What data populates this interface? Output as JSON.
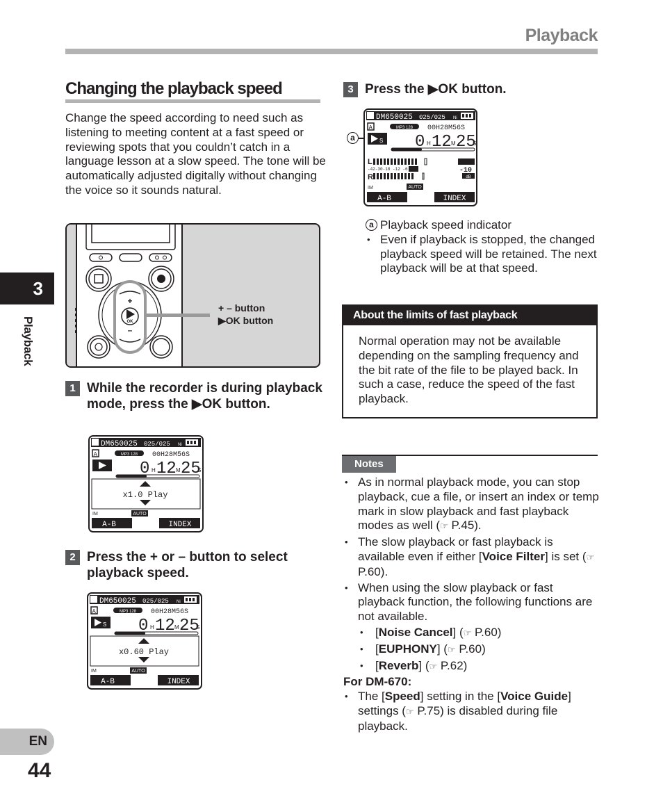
{
  "header": {
    "title": "Playback"
  },
  "side_tab": {
    "chapter_number": "3",
    "chapter_label": "Playback",
    "language": "EN",
    "page_number": "44"
  },
  "section": {
    "title": "Changing the playback speed",
    "intro": "Change the speed according to need such as listening to meeting content at a fast speed or reviewing spots that you couldn’t catch in a language lesson at a slow speed. The tone will be automatically adjusted digitally without changing the voice so it sounds natural."
  },
  "device_figure": {
    "label_plus_minus": "+ – button",
    "label_ok": "▶OK button",
    "plus_glyph": "+",
    "minus_glyph": "–",
    "ok_glyph": "OK"
  },
  "steps": [
    {
      "number": "1",
      "text": "While the recorder is during playback mode, press the ▶OK button."
    },
    {
      "number": "2",
      "text": "Press the + or – button to select playback speed."
    },
    {
      "number": "3",
      "text": "Press the ▶OK button."
    }
  ],
  "lcd_screens": [
    {
      "file": "DM650025",
      "count": "025/025",
      "battery": "Ni",
      "folder": "A",
      "format": "MP3 128",
      "length": "00H28M56S",
      "time_h": "0",
      "time_m": "12",
      "time_s": "25",
      "speed_label": "x1.0 Play",
      "mode_icon": "play",
      "mic": "AUTO",
      "soft_left": "A-B",
      "soft_right": "INDEX"
    },
    {
      "file": "DM650025",
      "count": "025/025",
      "battery": "Ni",
      "folder": "A",
      "format": "MP3 128",
      "length": "00H28M56S",
      "time_h": "0",
      "time_m": "12",
      "time_s": "25",
      "speed_label": "x0.60 Play",
      "mode_icon": "slow-play",
      "mic": "AUTO",
      "soft_left": "A-B",
      "soft_right": "INDEX"
    },
    {
      "file": "DM650025",
      "count": "025/025",
      "battery": "Ni",
      "folder": "A",
      "format": "MP3 128",
      "length": "00H28M56S",
      "time_h": "0",
      "time_m": "12",
      "time_s": "25",
      "mode_icon": "slow-play",
      "meter_scale": "-42-30-18  -12  -6  0",
      "meter_level": "-10",
      "meter_unit": "dB",
      "mic": "AUTO",
      "soft_left": "A-B",
      "soft_right": "INDEX",
      "callout": "a"
    }
  ],
  "callout_a": {
    "marker": "a",
    "label": "Playback speed indicator",
    "bullet": "Even if playback is stopped, the changed playback speed will be retained. The next playback will be at that speed."
  },
  "about_box": {
    "title": "About the limits of fast playback",
    "body": "Normal operation may not be available depending on the sampling frequency and the bit rate of the file to be played back. In such a case, reduce the speed of the fast playback."
  },
  "notes": {
    "title": "Notes",
    "items": [
      {
        "pre": "As in normal playback mode, you can stop playback, cue a file, or insert an index or temp mark in slow playback and fast playback modes as well (",
        "ref": "☞",
        "post": " P.45)."
      },
      {
        "pre": "The slow playback or fast playback is available even if either [",
        "bold": "Voice Filter",
        "post": "] is set (",
        "ref": "☞",
        "post2": " P.60)."
      },
      {
        "pre": "When using the slow playback or fast playback function, the following functions are not available."
      }
    ],
    "sub_items": [
      {
        "bold": "Noise Cancel",
        "ref": "☞",
        "page": "P.60"
      },
      {
        "bold": "EUPHONY",
        "ref": "☞",
        "page": "P.60"
      },
      {
        "bold": "Reverb",
        "ref": "☞",
        "page": "P.62"
      }
    ],
    "for_model": "For DM-670:",
    "model_item": {
      "pre": "The [",
      "bold1": "Speed",
      "mid": "] setting in the [",
      "bold2": "Voice Guide",
      "post": "] settings (",
      "ref": "☞",
      "post2": " P.75) is disabled during file playback."
    }
  }
}
